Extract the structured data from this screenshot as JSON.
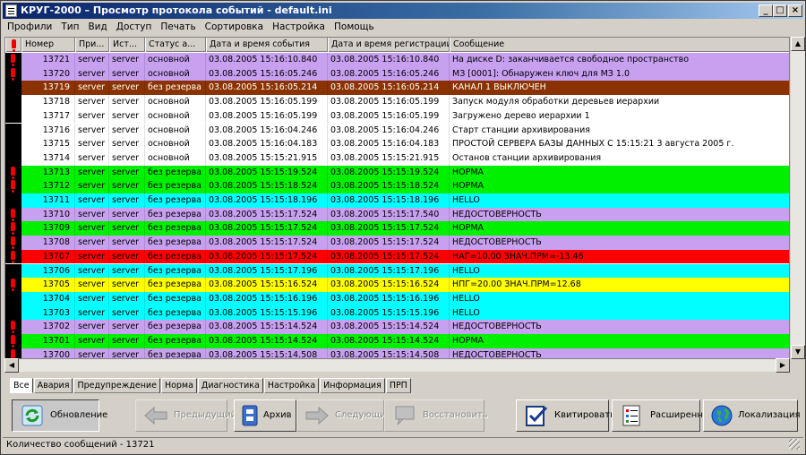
{
  "window": {
    "title": "КРУГ-2000 – Просмотр протокола событий - default.ini"
  },
  "menu": [
    "Профили",
    "Тип",
    "Вид",
    "Доступ",
    "Печать",
    "Сортировка",
    "Настройка",
    "Помощь"
  ],
  "columns": [
    "Номер",
    "При...",
    "Ист...",
    "Статус а...",
    "Дата и время события",
    "Дата и время регистрации",
    "Сообщение"
  ],
  "rows": [
    {
      "flag": true,
      "num": "13721",
      "p": "server",
      "s": "server",
      "st": "основной",
      "ev": "03.08.2005  15:16:10.840",
      "rg": "03.08.2005  15:16:10.840",
      "msg": "На диске D: заканчивается свободное пространство",
      "bg": "#c8a0f0",
      "fg": "#000000"
    },
    {
      "flag": true,
      "num": "13720",
      "p": "server",
      "s": "server",
      "st": "основной",
      "ev": "03.08.2005  15:16:05.246",
      "rg": "03.08.2005  15:16:05.246",
      "msg": "МЗ [0001]: Обнаружен ключ для МЗ 1.0",
      "bg": "#c8a0f0",
      "fg": "#000000"
    },
    {
      "flag": false,
      "num": "13719",
      "p": "server",
      "s": "server",
      "st": "без резерва",
      "ev": "03.08.2005  15:16:05.214",
      "rg": "03.08.2005  15:16:05.214",
      "msg": "КАНАЛ 1 ВЫКЛЮЧЕН",
      "bg": "#8b3300",
      "fg": "#ffffff"
    },
    {
      "flag": false,
      "num": "13718",
      "p": "server",
      "s": "server",
      "st": "основной",
      "ev": "03.08.2005  15:16:05.199",
      "rg": "03.08.2005  15:16:05.199",
      "msg": "Запуск модуля обработки деревьев иерархии",
      "bg": "#ffffff",
      "fg": "#000000"
    },
    {
      "flag": false,
      "num": "13717",
      "p": "server",
      "s": "server",
      "st": "основной",
      "ev": "03.08.2005  15:16:05.199",
      "rg": "03.08.2005  15:16:05.199",
      "msg": "Загружено дерево иерархии 1",
      "bg": "#ffffff",
      "fg": "#000000"
    },
    {
      "flag": false,
      "num": "13716",
      "p": "server",
      "s": "server",
      "st": "основной",
      "ev": "03.08.2005  15:16:04.246",
      "rg": "03.08.2005  15:16:04.246",
      "msg": "Старт станции архивирования",
      "bg": "#ffffff",
      "fg": "#000000"
    },
    {
      "flag": false,
      "num": "13715",
      "p": "server",
      "s": "server",
      "st": "основной",
      "ev": "03.08.2005  15:16:04.183",
      "rg": "03.08.2005  15:16:04.183",
      "msg": "ПРОСТОЙ СЕРВЕРА БАЗЫ ДАННЫХ С 15:15:21  3 августа 2005 г.",
      "bg": "#ffffff",
      "fg": "#000000"
    },
    {
      "flag": false,
      "num": "13714",
      "p": "server",
      "s": "server",
      "st": "основной",
      "ev": "03.08.2005  15:15:21.915",
      "rg": "03.08.2005  15:15:21.915",
      "msg": "Останов станции архивирования",
      "bg": "#ffffff",
      "fg": "#000000"
    },
    {
      "flag": true,
      "num": "13713",
      "p": "server",
      "s": "server",
      "st": "без резерва",
      "ev": "03.08.2005  15:15:19.524",
      "rg": "03.08.2005  15:15:19.524",
      "msg": "НОРМА",
      "bg": "#00f000",
      "fg": "#000000"
    },
    {
      "flag": true,
      "num": "13712",
      "p": "server",
      "s": "server",
      "st": "без резерва",
      "ev": "03.08.2005  15:15:18.524",
      "rg": "03.08.2005  15:15:18.524",
      "msg": "НОРМА",
      "bg": "#00f000",
      "fg": "#000000"
    },
    {
      "flag": false,
      "num": "13711",
      "p": "server",
      "s": "server",
      "st": "без резерва",
      "ev": "03.08.2005  15:15:18.196",
      "rg": "03.08.2005  15:15:18.196",
      "msg": "HELLO",
      "bg": "#00ffff",
      "fg": "#000000"
    },
    {
      "flag": true,
      "num": "13710",
      "p": "server",
      "s": "server",
      "st": "без резерва",
      "ev": "03.08.2005  15:15:17.524",
      "rg": "03.08.2005  15:15:17.540",
      "msg": "НЕДОСТОВЕРНОСТЬ",
      "bg": "#c8a0f0",
      "fg": "#000000"
    },
    {
      "flag": true,
      "num": "13709",
      "p": "server",
      "s": "server",
      "st": "без резерва",
      "ev": "03.08.2005  15:15:17.524",
      "rg": "03.08.2005  15:15:17.524",
      "msg": "НОРМА",
      "bg": "#00f000",
      "fg": "#000000"
    },
    {
      "flag": true,
      "num": "13708",
      "p": "server",
      "s": "server",
      "st": "без резерва",
      "ev": "03.08.2005  15:15:17.524",
      "rg": "03.08.2005  15:15:17.524",
      "msg": "НЕДОСТОВЕРНОСТЬ",
      "bg": "#c8a0f0",
      "fg": "#000000"
    },
    {
      "flag": true,
      "num": "13707",
      "p": "server",
      "s": "server",
      "st": "без резерва",
      "ev": "03.08.2005  15:15:17.524",
      "rg": "03.08.2005  15:15:17.524",
      "msg": "НАГ=10.00 ЗНАЧ.ПРМ=-13.46",
      "bg": "#ff0000",
      "fg": "#000000"
    },
    {
      "flag": false,
      "num": "13706",
      "p": "server",
      "s": "server",
      "st": "без резерва",
      "ev": "03.08.2005  15:15:17.196",
      "rg": "03.08.2005  15:15:17.196",
      "msg": "HELLO",
      "bg": "#00ffff",
      "fg": "#000000"
    },
    {
      "flag": true,
      "num": "13705",
      "p": "server",
      "s": "server",
      "st": "без резерва",
      "ev": "03.08.2005  15:15:16.524",
      "rg": "03.08.2005  15:15:16.524",
      "msg": "НПГ=20.00 ЗНАЧ.ПРМ=12.68",
      "bg": "#ffff00",
      "fg": "#000000"
    },
    {
      "flag": false,
      "num": "13704",
      "p": "server",
      "s": "server",
      "st": "без резерва",
      "ev": "03.08.2005  15:15:16.196",
      "rg": "03.08.2005  15:15:16.196",
      "msg": "HELLO",
      "bg": "#00ffff",
      "fg": "#000000"
    },
    {
      "flag": false,
      "num": "13703",
      "p": "server",
      "s": "server",
      "st": "без резерва",
      "ev": "03.08.2005  15:15:15.196",
      "rg": "03.08.2005  15:15:15.196",
      "msg": "HELLO",
      "bg": "#00ffff",
      "fg": "#000000"
    },
    {
      "flag": true,
      "num": "13702",
      "p": "server",
      "s": "server",
      "st": "без резерва",
      "ev": "03.08.2005  15:15:14.524",
      "rg": "03.08.2005  15:15:14.524",
      "msg": "НЕДОСТОВЕРНОСТЬ",
      "bg": "#c8a0f0",
      "fg": "#000000"
    },
    {
      "flag": true,
      "num": "13701",
      "p": "server",
      "s": "server",
      "st": "без резерва",
      "ev": "03.08.2005  15:15:14.524",
      "rg": "03.08.2005  15:15:14.524",
      "msg": "НОРМА",
      "bg": "#00f000",
      "fg": "#000000"
    },
    {
      "flag": true,
      "num": "13700",
      "p": "server",
      "s": "server",
      "st": "без резерва",
      "ev": "03.08.2005  15:15:14.508",
      "rg": "03.08.2005  15:15:14.508",
      "msg": "НЕДОСТОВЕРНОСТЬ",
      "bg": "#c8a0f0",
      "fg": "#000000"
    }
  ],
  "tabs": [
    "Все",
    "Авария",
    "Предупреждение",
    "Норма",
    "Диагностика",
    "Настройка",
    "Информация",
    "ПРП"
  ],
  "toolbar": {
    "refresh": "Обновление",
    "prev": "Предыдущий",
    "archive": "Архив",
    "next": "Следующий",
    "restore": "Восстановить",
    "ack": "Квитировать",
    "extended": "Расширенная",
    "localize": "Локализация"
  },
  "status": {
    "text": "Количество сообщений - 13721"
  }
}
